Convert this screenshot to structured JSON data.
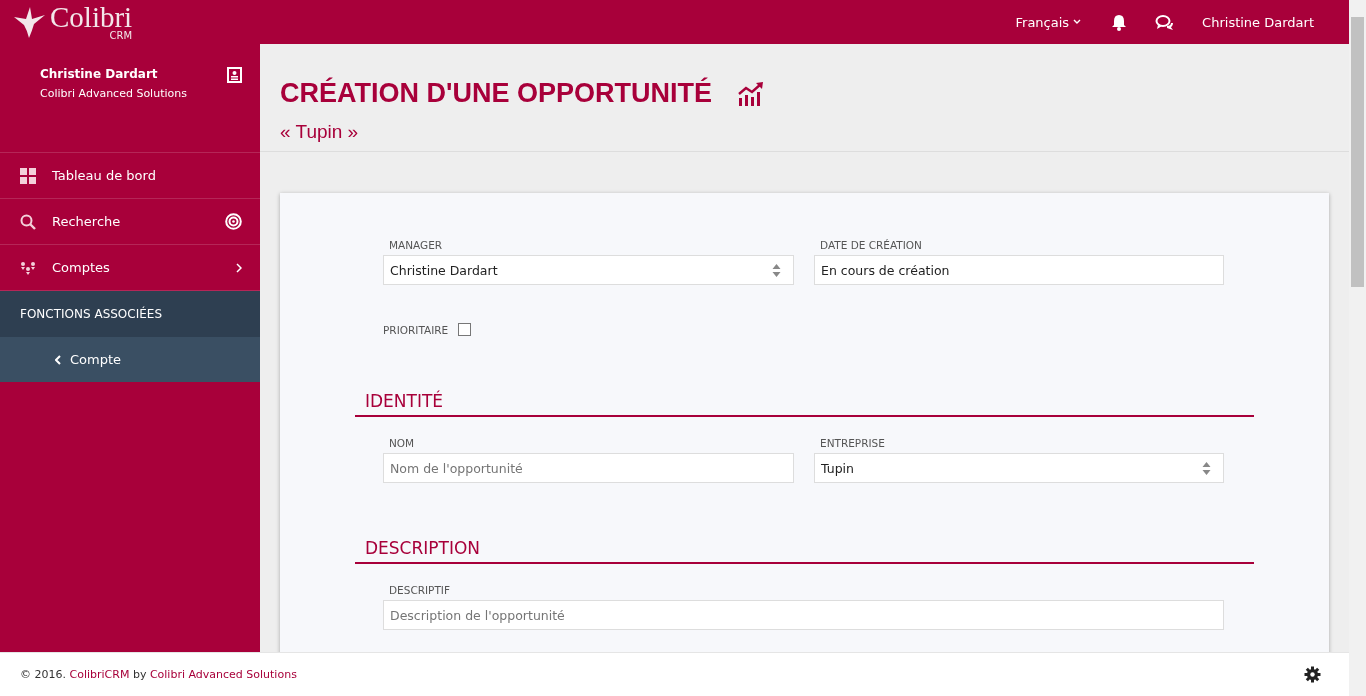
{
  "header": {
    "logo": "Colibri",
    "logo_sub": "CRM",
    "language": "Français",
    "user": "Christine Dardart"
  },
  "sidebar": {
    "user_name": "Christine Dardart",
    "company": "Colibri Advanced Solutions",
    "items": [
      {
        "label": "Tableau de bord",
        "kind": "dashboard"
      },
      {
        "label": "Recherche",
        "kind": "search"
      },
      {
        "label": "Comptes",
        "kind": "accounts"
      }
    ],
    "section": "FONCTIONS ASSOCIÉES",
    "sub_items": [
      {
        "label": "Compte"
      }
    ]
  },
  "page": {
    "title": "CRÉATION D'UNE OPPORTUNITÉ",
    "subtitle": "« Tupin »"
  },
  "form": {
    "top_fields": [
      {
        "label": "MANAGER",
        "kind": "select",
        "value": "Christine Dardart"
      },
      {
        "label": "DATE DE CRÉATION",
        "kind": "text",
        "value": "En cours de création"
      }
    ],
    "priority": {
      "label": "PRIORITAIRE",
      "checked": false
    },
    "sections": [
      {
        "title": "IDENTITÉ",
        "fields": [
          {
            "label": "NOM",
            "kind": "text",
            "placeholder": "Nom de l'opportunité"
          },
          {
            "label": "ENTREPRISE",
            "kind": "select",
            "value": "Tupin"
          }
        ]
      },
      {
        "title": "DESCRIPTION",
        "fields": [
          {
            "label": "DESCRIPTIF",
            "kind": "wide",
            "placeholder": "Description de l'opportunité"
          }
        ]
      }
    ]
  },
  "footer": {
    "prefix": "© 2016.",
    "link": "ColibriCRM",
    "middle": "by",
    "company_link": "Colibri Advanced Solutions"
  }
}
